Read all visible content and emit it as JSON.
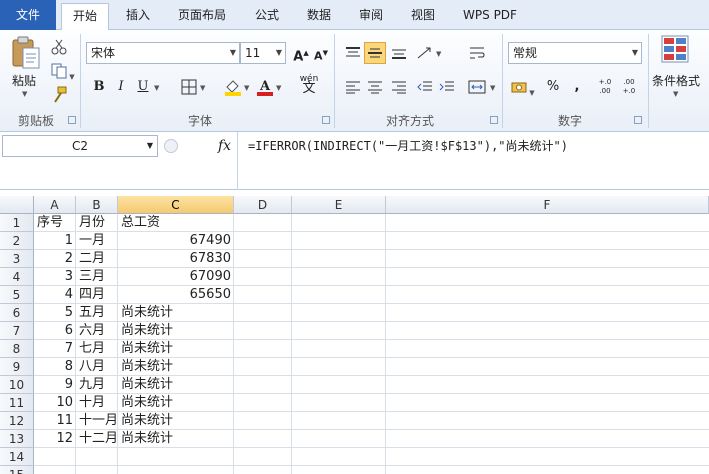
{
  "tabs": [
    "文件",
    "开始",
    "插入",
    "页面布局",
    "公式",
    "数据",
    "审阅",
    "视图",
    "WPS PDF"
  ],
  "ribbon": {
    "paste_label": "粘贴",
    "clipboard_label": "剪贴板",
    "font_name": "宋体",
    "font_size": "11",
    "font_group_label": "字体",
    "bold": "B",
    "italic": "I",
    "underline": "U",
    "align_group_label": "对齐方式",
    "number_format": "常规",
    "number_group_label": "数字",
    "percent": "%",
    "comma": ",",
    "inc_decimal": "+.0 .00",
    "dec_decimal": ".00 +.0",
    "cond_format_label": "条件格式",
    "font_color": "#d42020",
    "fill_color": "#ffd400",
    "wen_label": "wén"
  },
  "formula_bar": {
    "name_box": "C2",
    "fx": "fx",
    "formula": "=IFERROR(INDIRECT(\"一月工资!$F$13\"),\"尚未统计\")"
  },
  "sheet": {
    "columns": [
      "A",
      "B",
      "C",
      "D",
      "E",
      "F"
    ],
    "active_column": "C",
    "rows": [
      [
        "序号",
        "月份",
        "总工资"
      ],
      [
        "1",
        "一月",
        "67490"
      ],
      [
        "2",
        "二月",
        "67830"
      ],
      [
        "3",
        "三月",
        "67090"
      ],
      [
        "4",
        "四月",
        "65650"
      ],
      [
        "5",
        "五月",
        "尚未统计"
      ],
      [
        "6",
        "六月",
        "尚未统计"
      ],
      [
        "7",
        "七月",
        "尚未统计"
      ],
      [
        "8",
        "八月",
        "尚未统计"
      ],
      [
        "9",
        "九月",
        "尚未统计"
      ],
      [
        "10",
        "十月",
        "尚未统计"
      ],
      [
        "11",
        "十一月",
        "尚未统计"
      ],
      [
        "12",
        "十二月",
        "尚未统计"
      ],
      [
        "",
        "",
        ""
      ],
      [
        "",
        "",
        ""
      ]
    ],
    "row_numbers": [
      "1",
      "2",
      "3",
      "4",
      "5",
      "6",
      "7",
      "8",
      "9",
      "10",
      "11",
      "12",
      "13",
      "14",
      "15"
    ]
  }
}
